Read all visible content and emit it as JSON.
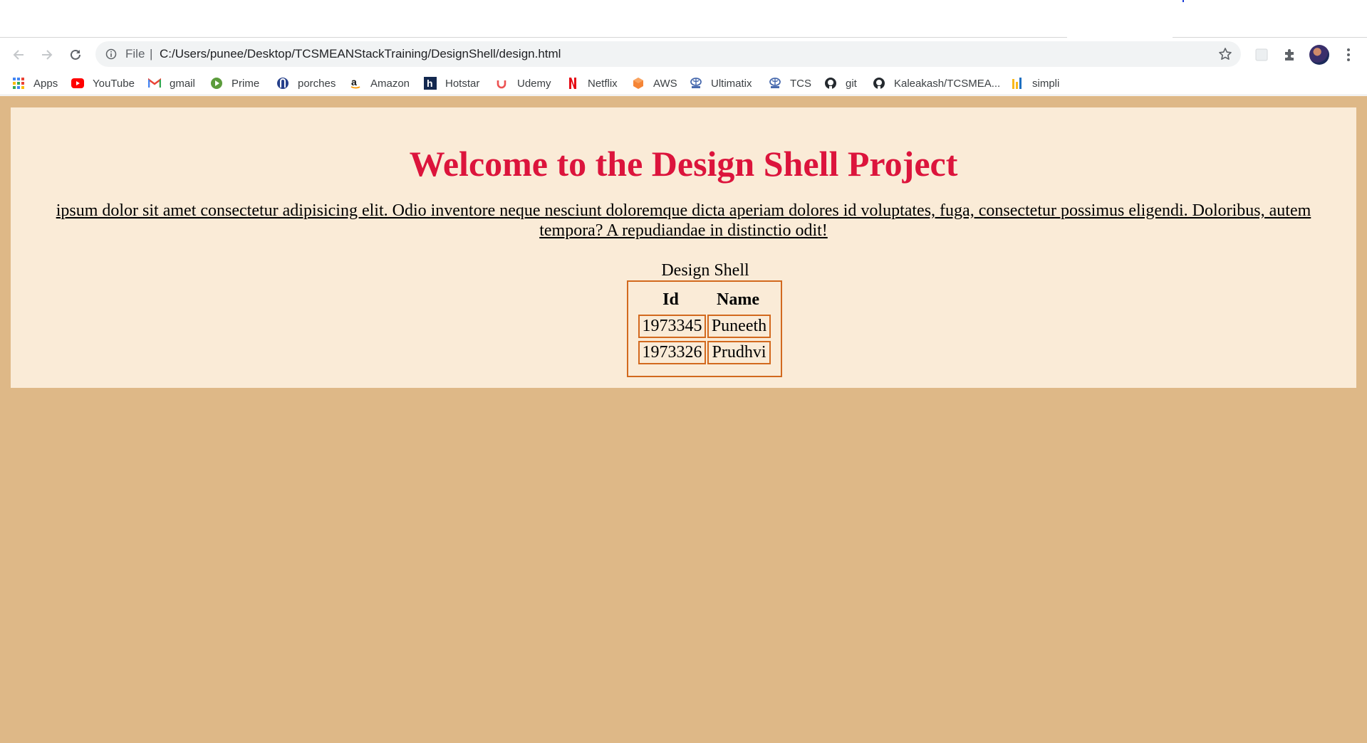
{
  "browser": {
    "address_bar": {
      "scheme_label": "File",
      "separator": "|",
      "url": "C:/Users/punee/Desktop/TCSMEANStackTraining/DesignShell/design.html"
    },
    "bookmarks": [
      {
        "label": "Apps",
        "icon": "apps-grid-icon"
      },
      {
        "label": "YouTube",
        "icon": "youtube-icon"
      },
      {
        "label": "gmail",
        "icon": "gmail-icon"
      },
      {
        "label": "Prime",
        "icon": "prime-icon"
      },
      {
        "label": "porches",
        "icon": "porches-icon"
      },
      {
        "label": "Amazon",
        "icon": "amazon-icon"
      },
      {
        "label": "Hotstar",
        "icon": "hotstar-icon"
      },
      {
        "label": "Udemy",
        "icon": "udemy-icon"
      },
      {
        "label": "Netflix",
        "icon": "netflix-icon"
      },
      {
        "label": "AWS",
        "icon": "aws-icon"
      },
      {
        "label": "Ultimatix",
        "icon": "tata-icon"
      },
      {
        "label": "TCS",
        "icon": "tata-icon"
      },
      {
        "label": "git",
        "icon": "github-icon"
      },
      {
        "label": "Kaleakash/TCSMEA...",
        "icon": "github-icon"
      },
      {
        "label": "simpli",
        "icon": "simplilearn-icon"
      }
    ]
  },
  "page": {
    "title": "Welcome to the Design Shell Project",
    "intro": "ipsum dolor sit amet consectetur adipisicing elit. Odio inventore neque nesciunt doloremque dicta aperiam dolores id voluptates, fuga, consectetur possimus eligendi. Doloribus, autem tempora? A repudiandae in distinctio odit!",
    "table": {
      "caption": "Design Shell",
      "headers": [
        "Id",
        "Name"
      ],
      "rows": [
        [
          "1973345",
          "Puneeth"
        ],
        [
          "1973326",
          "Prudhvi"
        ]
      ]
    }
  },
  "colors": {
    "page_background": "#deb887",
    "content_background": "#faebd7",
    "title_color": "#dc143c",
    "table_border": "#d2691e"
  }
}
